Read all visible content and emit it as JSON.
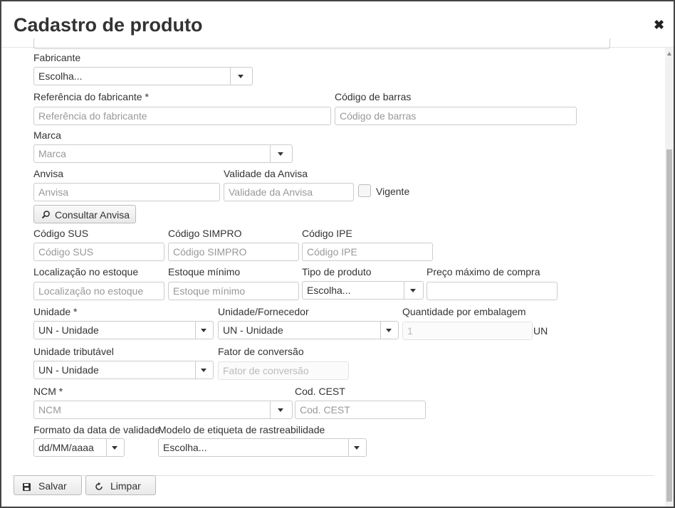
{
  "title": "Cadastro de produto",
  "form": {
    "fabricante": {
      "label": "Fabricante",
      "value": "Escolha..."
    },
    "ref_fabricante": {
      "label": "Referência do fabricante",
      "required": "*",
      "placeholder": "Referência do fabricante"
    },
    "cod_barras": {
      "label": "Código de barras",
      "placeholder": "Código de barras"
    },
    "marca": {
      "label": "Marca",
      "placeholder": "Marca"
    },
    "anvisa": {
      "label": "Anvisa",
      "placeholder": "Anvisa"
    },
    "validade_anvisa": {
      "label": "Validade da Anvisa",
      "placeholder": "Validade da Anvisa"
    },
    "vigente": {
      "label": "Vigente"
    },
    "consultar_anvisa": {
      "label": "Consultar Anvisa"
    },
    "cod_sus": {
      "label": "Código SUS",
      "placeholder": "Código SUS"
    },
    "cod_simpro": {
      "label": "Código SIMPRO",
      "placeholder": "Código SIMPRO"
    },
    "cod_ipe": {
      "label": "Código IPE",
      "placeholder": "Código IPE"
    },
    "localizacao": {
      "label": "Localização no estoque",
      "placeholder": "Localização no estoque"
    },
    "estoque_minimo": {
      "label": "Estoque mínimo",
      "placeholder": "Estoque mínimo"
    },
    "tipo_produto": {
      "label": "Tipo de produto",
      "value": "Escolha..."
    },
    "preco_maximo": {
      "label": "Preço máximo de compra",
      "value": ""
    },
    "unidade": {
      "label": "Unidade",
      "required": "*",
      "value": "UN - Unidade"
    },
    "unidade_fornecedor": {
      "label": "Unidade/Fornecedor",
      "value": "UN - Unidade"
    },
    "qtd_embalagem": {
      "label": "Quantidade por embalagem",
      "placeholder": "1",
      "suffix": "UN"
    },
    "unidade_tributavel": {
      "label": "Unidade tributável",
      "value": "UN - Unidade"
    },
    "fator_conversao": {
      "label": "Fator de conversão",
      "placeholder": "Fator de conversão"
    },
    "ncm": {
      "label": "NCM",
      "required": "*",
      "placeholder": "NCM"
    },
    "cod_cest": {
      "label": "Cod. CEST",
      "placeholder": "Cod. CEST"
    },
    "formato_validade": {
      "label": "Formato da data de validade",
      "value": "dd/MM/aaaa"
    },
    "modelo_etiqueta": {
      "label": "Modelo de etiqueta de rastreabilidade",
      "value": "Escolha..."
    }
  },
  "footer": {
    "save_label": "Salvar",
    "clear_label": "Limpar"
  },
  "icons": {
    "close": "close-icon",
    "search": "search-icon",
    "save": "floppy-disk-icon",
    "clear": "refresh-icon"
  }
}
